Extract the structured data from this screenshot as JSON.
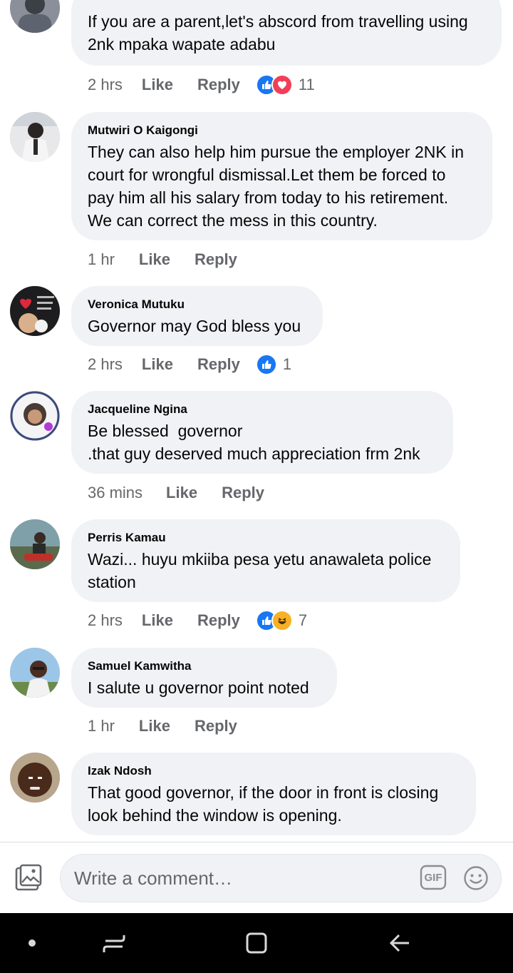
{
  "comments": [
    {
      "author": "",
      "text": "If you are a parent,let's abscord from travelling using 2nk mpaka wapate adabu",
      "time": "2 hrs",
      "like_label": "Like",
      "reply_label": "Reply",
      "reactions": [
        "like-icon",
        "love-icon"
      ],
      "reaction_count": "11"
    },
    {
      "author": "Mutwiri O Kaigongi",
      "text": "They can also help him pursue the employer 2NK in court for wrongful dismissal.Let them be forced to pay him all his salary from today to his retirement. We can correct the mess in this country.",
      "time": "1 hr",
      "like_label": "Like",
      "reply_label": "Reply",
      "reactions": [],
      "reaction_count": ""
    },
    {
      "author": "Veronica Mutuku",
      "text": "Governor may God bless you",
      "time": "2 hrs",
      "like_label": "Like",
      "reply_label": "Reply",
      "reactions": [
        "like-icon"
      ],
      "reaction_count": "1"
    },
    {
      "author": "Jacqueline Ngina",
      "text": "Be blessed  governor\n.that guy deserved much appreciation frm 2nk",
      "time": "36 mins",
      "like_label": "Like",
      "reply_label": "Reply",
      "reactions": [],
      "reaction_count": ""
    },
    {
      "author": "Perris Kamau",
      "text": "Wazi... huyu mkiiba pesa yetu anawaleta police station",
      "time": "2 hrs",
      "like_label": "Like",
      "reply_label": "Reply",
      "reactions": [
        "like-icon",
        "haha-icon"
      ],
      "reaction_count": "7"
    },
    {
      "author": "Samuel Kamwitha",
      "text": "I salute u governor point noted",
      "time": "1 hr",
      "like_label": "Like",
      "reply_label": "Reply",
      "reactions": [],
      "reaction_count": ""
    },
    {
      "author": "Izak Ndosh",
      "text": "That good governor, if the door in front is closing look behind the window is opening.",
      "time": "",
      "like_label": "",
      "reply_label": "",
      "reactions": [],
      "reaction_count": ""
    }
  ],
  "composer": {
    "placeholder": "Write a comment…",
    "gif_label": "GIF",
    "photo_icon": "photo-icon",
    "emoji_icon": "emoji-icon"
  },
  "navbar": {
    "icons": [
      "dot-icon",
      "recent-apps-icon",
      "home-icon",
      "back-icon"
    ]
  },
  "colors": {
    "bubble": "#f0f2f5",
    "meta_text": "#65676b",
    "like_blue": "#1877f2",
    "love_red": "#f33e58",
    "haha_yellow": "#f7b125"
  }
}
